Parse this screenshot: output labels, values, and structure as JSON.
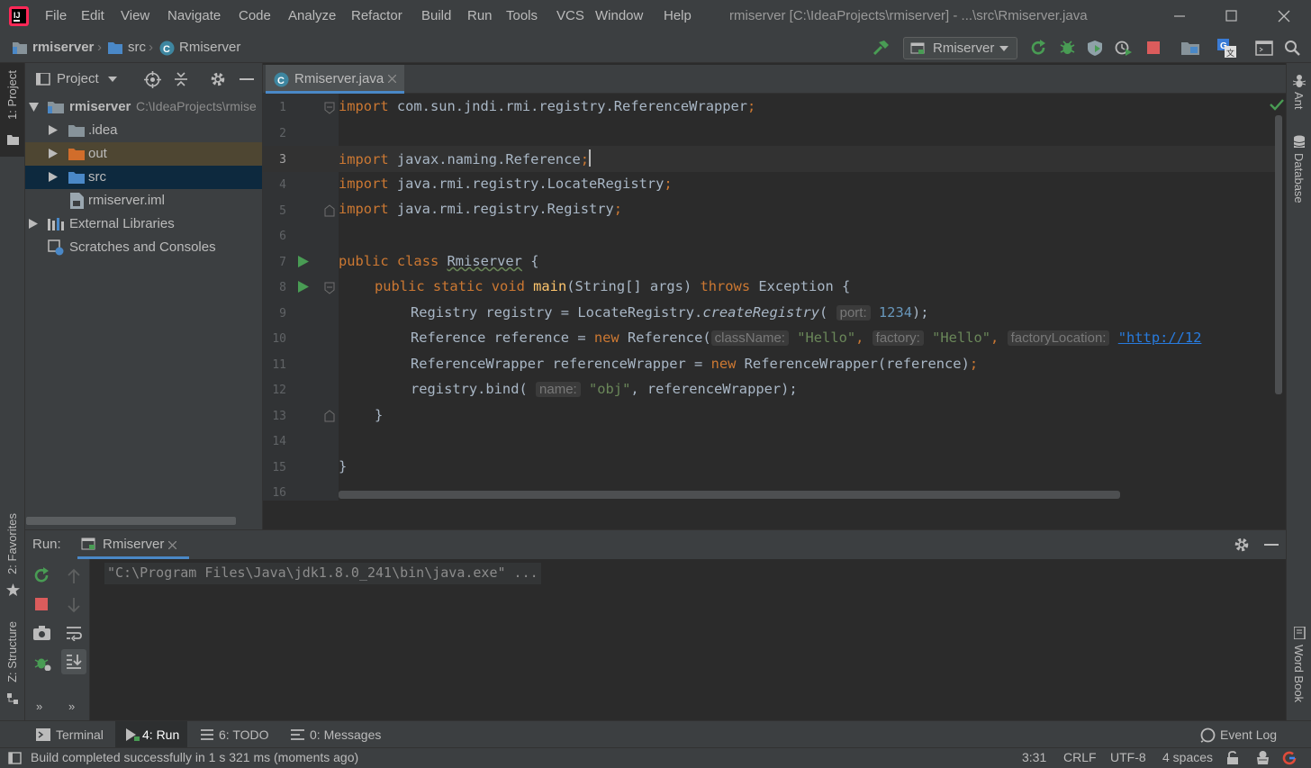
{
  "titlebar": {
    "menus": [
      "File",
      "Edit",
      "View",
      "Navigate",
      "Code",
      "Analyze",
      "Refactor",
      "Build",
      "Run",
      "Tools",
      "VCS",
      "Window",
      "Help"
    ],
    "title": "rmiserver [C:\\IdeaProjects\\rmiserver] - ...\\src\\Rmiserver.java"
  },
  "navbar": {
    "breadcrumbs": [
      "rmiserver",
      "src",
      "Rmiserver"
    ],
    "run_config": "Rmiserver"
  },
  "left_strip": {
    "project_tab": "1: Project",
    "favorites_tab": "2: Favorites",
    "structure_tab": "Z: Structure"
  },
  "right_strip": {
    "ant_tab": "Ant",
    "database_tab": "Database",
    "wordbook_tab": "Word Book"
  },
  "project": {
    "header": "Project",
    "tree": [
      {
        "label": "rmiserver",
        "path": "C:\\IdeaProjects\\rmise"
      },
      {
        "label": ".idea"
      },
      {
        "label": "out"
      },
      {
        "label": "src"
      },
      {
        "label": "rmiserver.iml"
      },
      {
        "label": "External Libraries"
      },
      {
        "label": "Scratches and Consoles"
      }
    ]
  },
  "editor": {
    "tab": "Rmiserver.java",
    "line_numbers": [
      "1",
      "2",
      "3",
      "4",
      "5",
      "6",
      "7",
      "8",
      "9",
      "10",
      "11",
      "12",
      "13",
      "14",
      "15",
      "16"
    ],
    "code": {
      "l1_import": "import",
      "l1_rest": " com.sun.jndi.rmi.registry.ReferenceWrapper",
      "semi": ";",
      "l3_rest": " javax.naming.Reference",
      "l4_rest": " java.rmi.registry.LocateRegistry",
      "l5_rest": " java.rmi.registry.Registry",
      "public": "public",
      "class": "class",
      "classname": "Rmiserver",
      "brace_open": " {",
      "static": "static",
      "void": "void",
      "main": "main",
      "main_args": "(String[] args) ",
      "throws": "throws",
      "exception": " Exception {",
      "l9_a": "Registry registry = LocateRegistry.",
      "l9_method": "createRegistry",
      "paren": "(",
      "port_hint": "port:",
      "port_val": "1234",
      "close_semi": ");",
      "l10_a": "Reference reference = ",
      "new": "new",
      "l10_b": " Reference(",
      "classname_hint": "className:",
      "hello": "\"Hello\"",
      "comma": ", ",
      "factory_hint": "factory:",
      "factoryloc_hint": "factoryLocation:",
      "url": "\"http://12",
      "l11_a": "ReferenceWrapper referenceWrapper = ",
      "l11_b": " ReferenceWrapper(reference)",
      "l12_a": "registry.bind(",
      "name_hint": "name:",
      "obj": "\"obj\"",
      "l12_b": ", referenceWrapper",
      "brace_close": "}"
    }
  },
  "run": {
    "label": "Run:",
    "tab": "Rmiserver",
    "console": "\"C:\\Program Files\\Java\\jdk1.8.0_241\\bin\\java.exe\" ..."
  },
  "toolwindows": {
    "terminal": "Terminal",
    "run": "4: Run",
    "todo": "6: TODO",
    "messages": "0: Messages",
    "event_log": "Event Log"
  },
  "status": {
    "message": "Build completed successfully in 1 s 321 ms (moments ago)",
    "position": "3:31",
    "line_sep": "CRLF",
    "encoding": "UTF-8",
    "indent": "4 spaces"
  },
  "colors": {
    "bg": "#2b2b2b",
    "panel": "#3c3f41",
    "keyword": "#cc7832",
    "string": "#6a8759",
    "number": "#6897bb",
    "method": "#ffc66d",
    "selection": "#0d293e"
  }
}
